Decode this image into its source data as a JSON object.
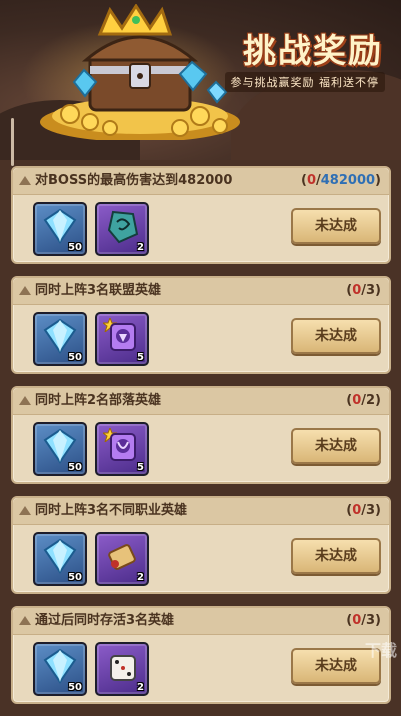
{
  "header": {
    "title": "挑战奖励",
    "subtitle": "参与挑战赢奖励 福利送不停"
  },
  "tasks": [
    {
      "title": "对BOSS的最高伤害达到482000",
      "progress_current": "0",
      "progress_total": "482000",
      "status": "未达成",
      "rewards": [
        {
          "icon": "diamond-icon",
          "color": "blue",
          "qty": "50"
        },
        {
          "icon": "rune-stone-icon",
          "color": "purple",
          "qty": "2"
        }
      ]
    },
    {
      "title": "同时上阵3名联盟英雄",
      "progress_current": "0",
      "progress_total": "3",
      "status": "未达成",
      "rewards": [
        {
          "icon": "diamond-icon",
          "color": "blue",
          "qty": "50"
        },
        {
          "icon": "hero-shard-icon",
          "color": "purple",
          "qty": "5"
        }
      ]
    },
    {
      "title": "同时上阵2名部落英雄",
      "progress_current": "0",
      "progress_total": "2",
      "status": "未达成",
      "rewards": [
        {
          "icon": "diamond-icon",
          "color": "blue",
          "qty": "50"
        },
        {
          "icon": "hero-shard-icon",
          "color": "purple",
          "qty": "5"
        }
      ]
    },
    {
      "title": "同时上阵3名不同职业英雄",
      "progress_current": "0",
      "progress_total": "3",
      "status": "未达成",
      "rewards": [
        {
          "icon": "diamond-icon",
          "color": "blue",
          "qty": "50"
        },
        {
          "icon": "scroll-icon",
          "color": "purple",
          "qty": "2"
        }
      ]
    },
    {
      "title": "通过后同时存活3名英雄",
      "progress_current": "0",
      "progress_total": "3",
      "status": "未达成",
      "rewards": [
        {
          "icon": "diamond-icon",
          "color": "blue",
          "qty": "50"
        },
        {
          "icon": "dice-icon",
          "color": "purple",
          "qty": "2"
        }
      ]
    }
  ],
  "watermark": "下载"
}
